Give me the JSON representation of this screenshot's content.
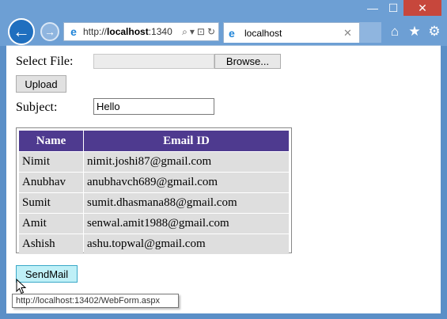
{
  "window": {
    "minimize_glyph": "—",
    "maximize_glyph": "☐",
    "close_glyph": "✕"
  },
  "nav": {
    "back_glyph": "←",
    "forward_glyph": "→"
  },
  "address_bar": {
    "prefix": "http://",
    "host": "localhost",
    "suffix": ":1340",
    "icon": "ie-icon",
    "tools": [
      "⌕",
      "▾",
      "⊡",
      "↻"
    ]
  },
  "tab": {
    "title": "localhost",
    "close_glyph": "✕"
  },
  "toolbar_icons": {
    "home": "⌂",
    "favorites": "★",
    "tools": "⚙"
  },
  "form": {
    "select_file_label": "Select File:",
    "browse_label": "Browse...",
    "upload_label": "Upload",
    "subject_label": "Subject:",
    "subject_value": "Hello",
    "sendmail_label": "SendMail"
  },
  "table": {
    "headers": [
      "Name",
      "Email ID"
    ],
    "rows": [
      [
        "Nimit",
        "nimit.joshi87@gmail.com"
      ],
      [
        "Anubhav",
        "anubhavch689@gmail.com"
      ],
      [
        "Sumit",
        "sumit.dhasmana88@gmail.com"
      ],
      [
        "Amit",
        "senwal.amit1988@gmail.com"
      ],
      [
        "Ashish",
        "ashu.topwal@gmail.com"
      ]
    ],
    "header_color": "#4e3a8f"
  },
  "tooltip": {
    "text": "http://localhost:13402/WebForm.aspx"
  },
  "colors": {
    "chrome": "#6d9fd4",
    "close_button": "#c7473c",
    "sendmail_bg": "#bff0f7"
  }
}
